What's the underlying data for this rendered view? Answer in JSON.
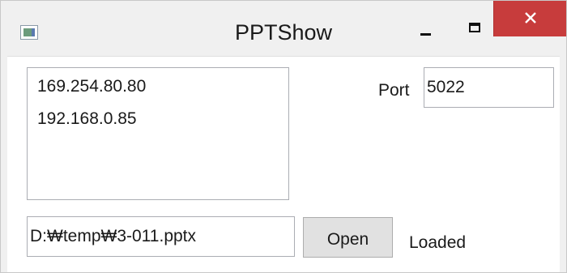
{
  "window": {
    "title": "PPTShow",
    "close_button_color": "#c73c3c",
    "icons": {
      "app": "app-icon",
      "minimize": "minimize-icon",
      "maximize": "maximize-icon",
      "close": "close-icon"
    }
  },
  "ip_list": {
    "items": [
      {
        "label": "169.254.80.80"
      },
      {
        "label": "192.168.0.85"
      }
    ]
  },
  "port": {
    "label": "Port",
    "value": "5022"
  },
  "file": {
    "path_value": "D:₩temp₩3-011.pptx",
    "open_label": "Open",
    "status": "Loaded"
  }
}
